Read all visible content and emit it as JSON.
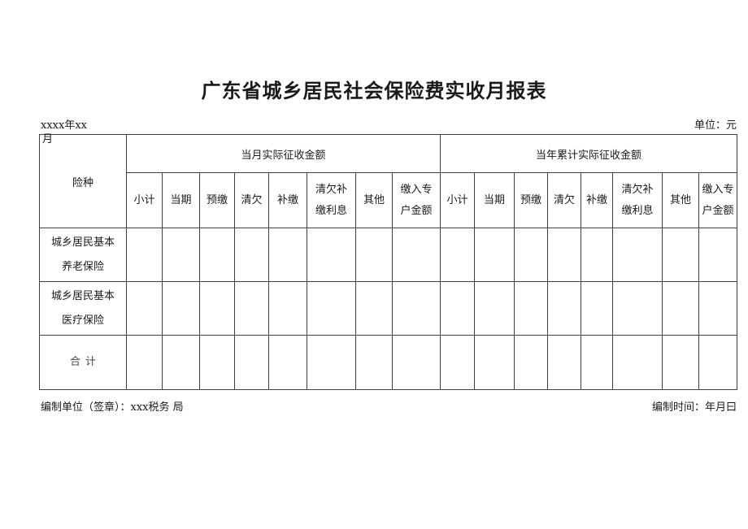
{
  "document": {
    "title": "广东省城乡居民社会保险费实收月报表",
    "period_label": "xxxx年xx月",
    "period_line1": "xxxx年xx",
    "period_line2": "月",
    "unit_label": "单位：元"
  },
  "table": {
    "row_header_label": "险种",
    "groups": [
      {
        "label": "当月实际征收金额"
      },
      {
        "label": "当年累计实际征收金额"
      }
    ],
    "subcolumns": [
      {
        "label": "小计",
        "line1": "小计",
        "line2": ""
      },
      {
        "label": "当期",
        "line1": "当期",
        "line2": ""
      },
      {
        "label": "预缴",
        "line1": "预缴",
        "line2": ""
      },
      {
        "label": "清欠",
        "line1": "清欠",
        "line2": ""
      },
      {
        "label": "补缴",
        "line1": "补缴",
        "line2": ""
      },
      {
        "label": "清欠补缴利息",
        "line1": "清欠补",
        "line2": "缴利息"
      },
      {
        "label": "其他",
        "line1": "其他",
        "line2": ""
      },
      {
        "label": "缴入专户金额",
        "line1": "缴入专",
        "line2": "户金额"
      }
    ],
    "rows": [
      {
        "label": "城乡居民基本养老保险",
        "line1": "城乡居民基本",
        "line2": "养老保险",
        "values": [
          "",
          "",
          "",
          "",
          "",
          "",
          "",
          "",
          "",
          "",
          "",
          "",
          "",
          "",
          "",
          ""
        ]
      },
      {
        "label": "城乡居民基本医疗保险",
        "line1": "城乡居民基本",
        "line2": "医疗保险",
        "values": [
          "",
          "",
          "",
          "",
          "",
          "",
          "",
          "",
          "",
          "",
          "",
          "",
          "",
          "",
          "",
          ""
        ]
      },
      {
        "label": "合计",
        "line1": "合计",
        "line2": "",
        "values": [
          "",
          "",
          "",
          "",
          "",
          "",
          "",
          "",
          "",
          "",
          "",
          "",
          "",
          "",
          "",
          ""
        ]
      }
    ]
  },
  "footer": {
    "prepared_by_line1": "编制单位（签章）：xxx税务",
    "prepared_by_line2": "局",
    "prepared_by": "编制单位（签章）：xxx税务局",
    "prepared_time": "编制时间：年月曰"
  }
}
